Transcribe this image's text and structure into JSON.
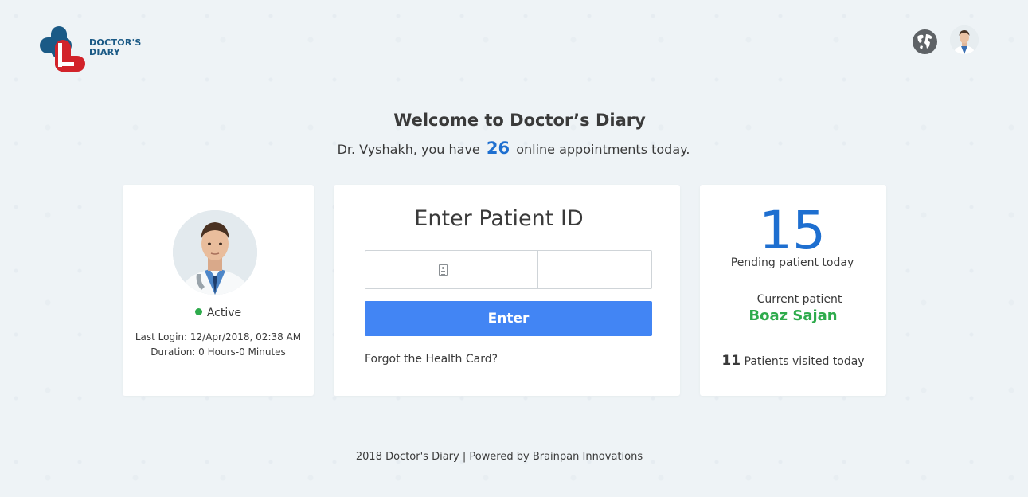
{
  "brand": {
    "name_line1": "DOCTOR'S",
    "name_line2": "DIARY",
    "colors": {
      "blue": "#1b5a86",
      "red": "#d2232a"
    }
  },
  "header": {
    "language_icon": "globe-icon",
    "avatar_icon": "user-avatar"
  },
  "welcome": {
    "title": "Welcome to Doctor’s Diary",
    "subtitle_prefix": "Dr. Vyshakh, you have",
    "appointments_count": "26",
    "subtitle_suffix": "online appointments today."
  },
  "profile": {
    "status": "Active",
    "last_login": "Last Login: 12/Apr/2018, 02:38 AM",
    "duration": "Duration: 0 Hours-0 Minutes",
    "status_color": "#2eab4c"
  },
  "patient_entry": {
    "title": "Enter Patient ID",
    "field_1": {
      "value": "",
      "placeholder": "",
      "icon": "id-card-icon"
    },
    "field_2": {
      "value": "",
      "placeholder": ""
    },
    "field_3": {
      "value": "",
      "placeholder": ""
    },
    "enter_label": "Enter",
    "forgot_label": "Forgot the Health Card?",
    "button_color": "#4285f4"
  },
  "stats": {
    "pending_count": "15",
    "pending_label": "Pending patient today",
    "current_label": "Current patient",
    "current_name": "Boaz Sajan",
    "visited_count": "11",
    "visited_label": "Patients visited  today",
    "accent_color": "#1e6fd0"
  },
  "footer": {
    "text": "2018 Doctor's Diary | Powered by Brainpan Innovations"
  }
}
